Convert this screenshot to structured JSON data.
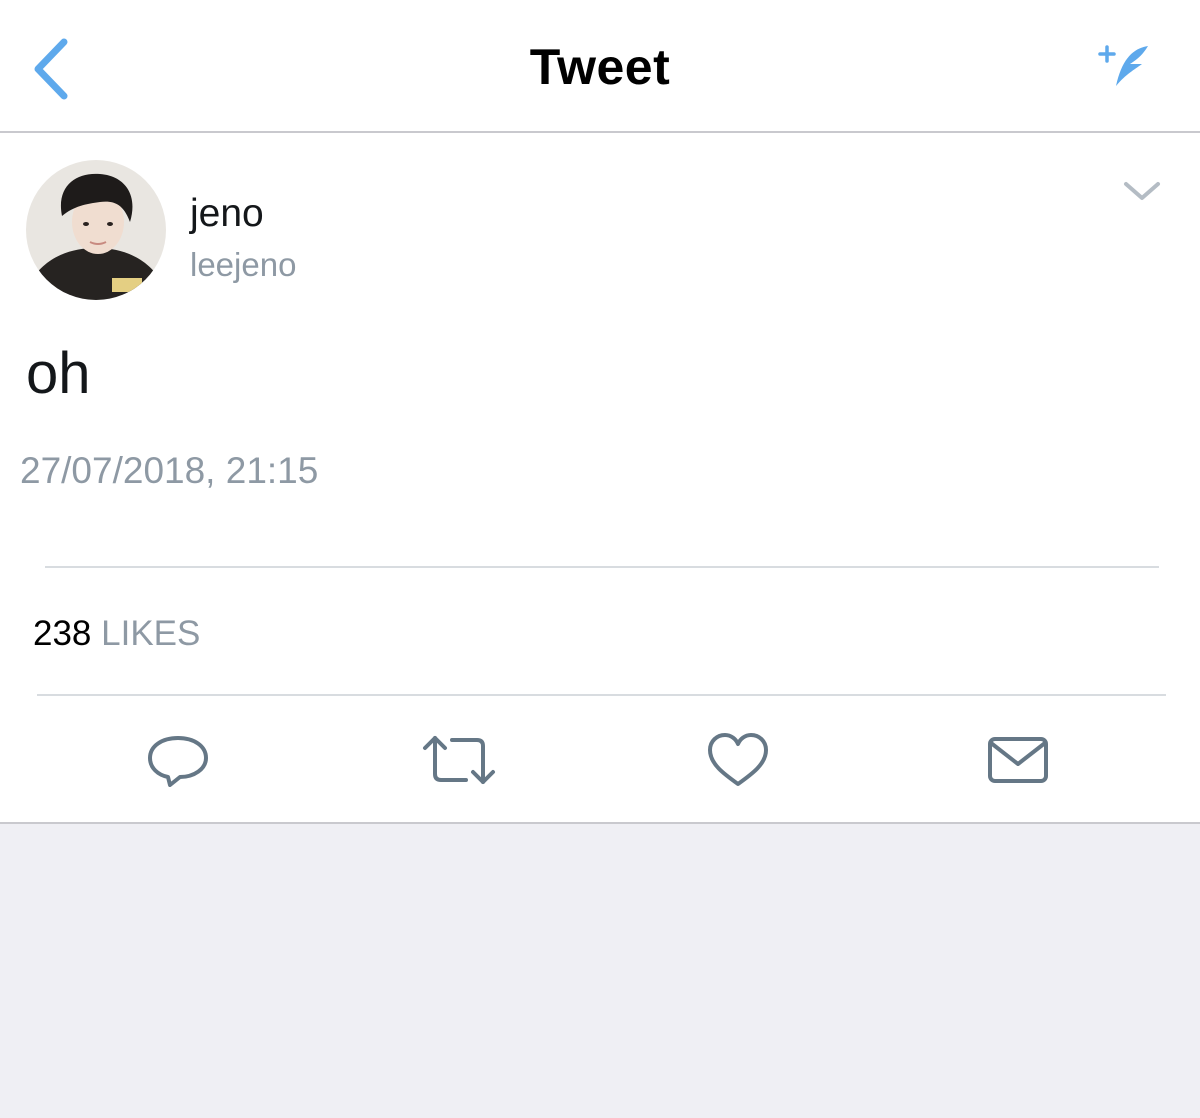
{
  "nav": {
    "title": "Tweet",
    "back_icon": "chevron-left-icon",
    "compose_icon": "compose-feather-icon",
    "accent_color": "#5ea9ec"
  },
  "tweet": {
    "user": {
      "name": "jeno",
      "handle": "leejeno"
    },
    "text": "oh",
    "timestamp": "27/07/2018, 21:15",
    "likes_count": "238",
    "likes_label": "LIKES"
  },
  "actions": [
    {
      "icon": "reply-icon"
    },
    {
      "icon": "retweet-icon"
    },
    {
      "icon": "heart-icon"
    },
    {
      "icon": "direct-message-icon"
    }
  ],
  "colors": {
    "secondary_text": "#8e99a4",
    "icon_stroke": "#657786",
    "background": "#efeff4"
  }
}
